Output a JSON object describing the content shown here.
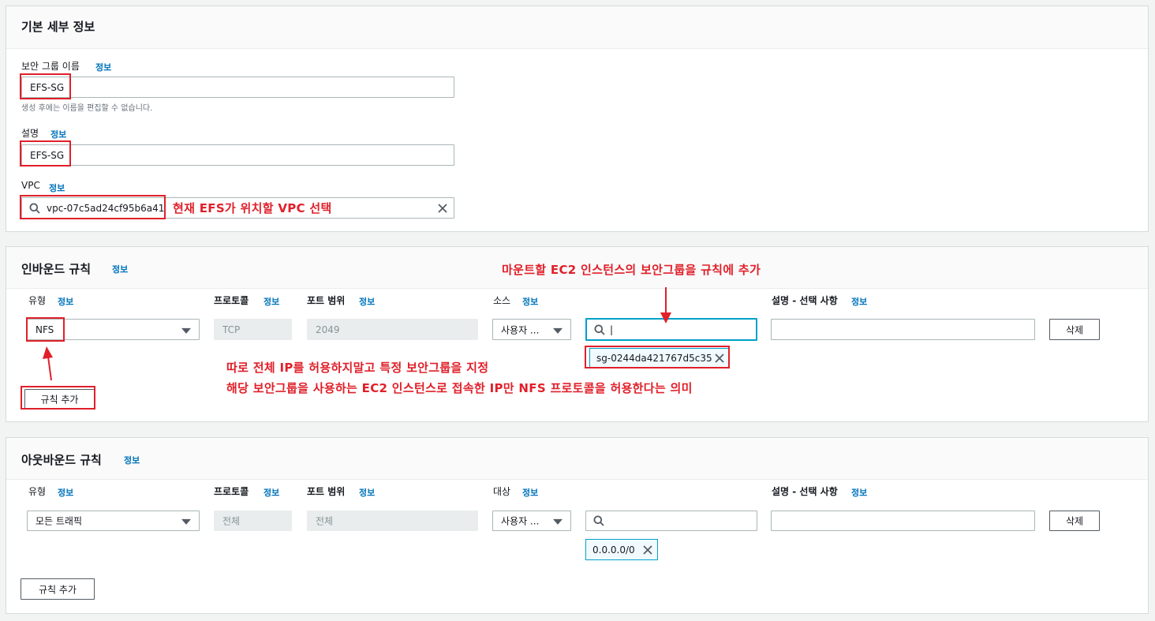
{
  "basic": {
    "title": "기본 세부 정보",
    "name_label": "보안 그룹 이름",
    "info": "정보",
    "name_value": "EFS-SG",
    "name_hint": "생성 후에는 이름을 편집할 수 없습니다.",
    "desc_label": "설명",
    "desc_value": "EFS-SG",
    "vpc_label": "VPC",
    "vpc_value": "vpc-07c5ad24cf95b6a41",
    "vpc_annotation": "현재 EFS가 위치할 VPC 선택"
  },
  "inbound": {
    "title": "인바운드 규칙",
    "info": "정보",
    "annotation_top": "마운트할 EC2 인스턴스의 보안그룹을 규칙에 추가",
    "col_type": "유형",
    "col_protocol": "프로토콜",
    "col_port": "포트 범위",
    "col_source": "소스",
    "col_desc": "설명 - 선택 사항",
    "type_value": "NFS",
    "protocol_value": "TCP",
    "port_value": "2049",
    "source_value": "사용자 ...",
    "search_value": "|",
    "token": "sg-0244da421767d5c35",
    "delete_label": "삭제",
    "add_rule_label": "규칙 추가",
    "annotation_line1": "따로 전체 IP를 허용하지말고 특정 보안그룹을 지정",
    "annotation_line2": "해당 보안그룹을 사용하는 EC2 인스턴스로 접속한 IP만  NFS 프로토콜을 허용한다는 의미"
  },
  "outbound": {
    "title": "아웃바운드 규칙",
    "info": "정보",
    "col_type": "유형",
    "col_protocol": "프로토콜",
    "col_port": "포트 범위",
    "col_dest": "대상",
    "col_desc": "설명 - 선택 사항",
    "type_value": "모든 트래픽",
    "protocol_value": "전체",
    "port_value": "전체",
    "dest_value": "사용자 ...",
    "token": "0.0.0.0/0",
    "delete_label": "삭제",
    "add_rule_label": "규칙 추가"
  },
  "colors": {
    "annotation_red": "#e0202a",
    "link_blue": "#0073bb",
    "focus_blue": "#00a1c9"
  }
}
